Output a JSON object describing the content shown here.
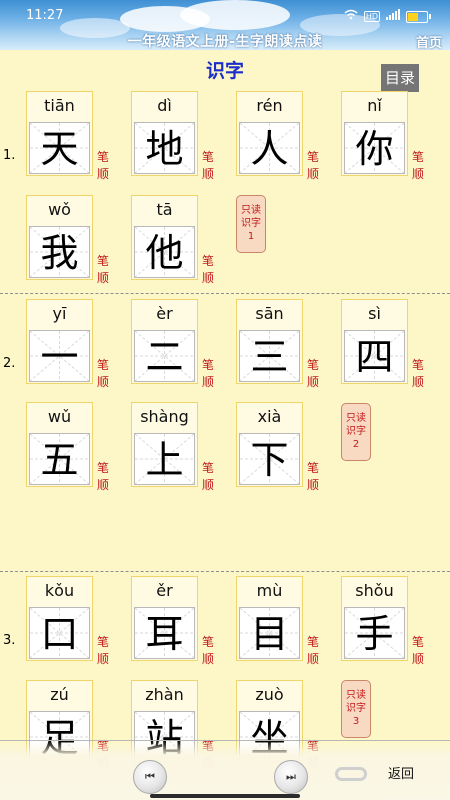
{
  "status": {
    "time": "11:27",
    "icons": [
      "wifi-icon",
      "hd-icon",
      "signal-icon",
      "battery-icon"
    ]
  },
  "header": {
    "title": "一年级语文上册-生字朗读点读",
    "home_label": "首页"
  },
  "section": {
    "title": "识字",
    "toc_label": "目录"
  },
  "labels": {
    "stroke_line1": "笔",
    "stroke_line2": "顺"
  },
  "groups": [
    {
      "number": "1.",
      "badge": {
        "line1": "只读",
        "line2": "识字",
        "line3": "1"
      },
      "chars": [
        {
          "pinyin": "tiān",
          "hanzi": "天"
        },
        {
          "pinyin": "dì",
          "hanzi": "地"
        },
        {
          "pinyin": "rén",
          "hanzi": "人"
        },
        {
          "pinyin": "nǐ",
          "hanzi": "你"
        },
        {
          "pinyin": "wǒ",
          "hanzi": "我"
        },
        {
          "pinyin": "tā",
          "hanzi": "他"
        }
      ]
    },
    {
      "number": "2.",
      "badge": {
        "line1": "只读",
        "line2": "识字",
        "line3": "2"
      },
      "chars": [
        {
          "pinyin": "yī",
          "hanzi": "一"
        },
        {
          "pinyin": "èr",
          "hanzi": "二"
        },
        {
          "pinyin": "sān",
          "hanzi": "三"
        },
        {
          "pinyin": "sì",
          "hanzi": "四"
        },
        {
          "pinyin": "wǔ",
          "hanzi": "五"
        },
        {
          "pinyin": "shàng",
          "hanzi": "上"
        },
        {
          "pinyin": "xià",
          "hanzi": "下"
        }
      ]
    },
    {
      "number": "3.",
      "badge": {
        "line1": "只读",
        "line2": "识字",
        "line3": "3"
      },
      "chars": [
        {
          "pinyin": "kǒu",
          "hanzi": "口"
        },
        {
          "pinyin": "ěr",
          "hanzi": "耳"
        },
        {
          "pinyin": "mù",
          "hanzi": "目"
        },
        {
          "pinyin": "shǒu",
          "hanzi": "手"
        },
        {
          "pinyin": "zú",
          "hanzi": "足"
        },
        {
          "pinyin": "zhàn",
          "hanzi": "站"
        },
        {
          "pinyin": "zuò",
          "hanzi": "坐"
        }
      ]
    }
  ],
  "controls": {
    "back_label": "返回",
    "prev_icon": "prev-track-icon",
    "next_icon": "next-track-icon",
    "loop_icon": "loop-icon"
  }
}
